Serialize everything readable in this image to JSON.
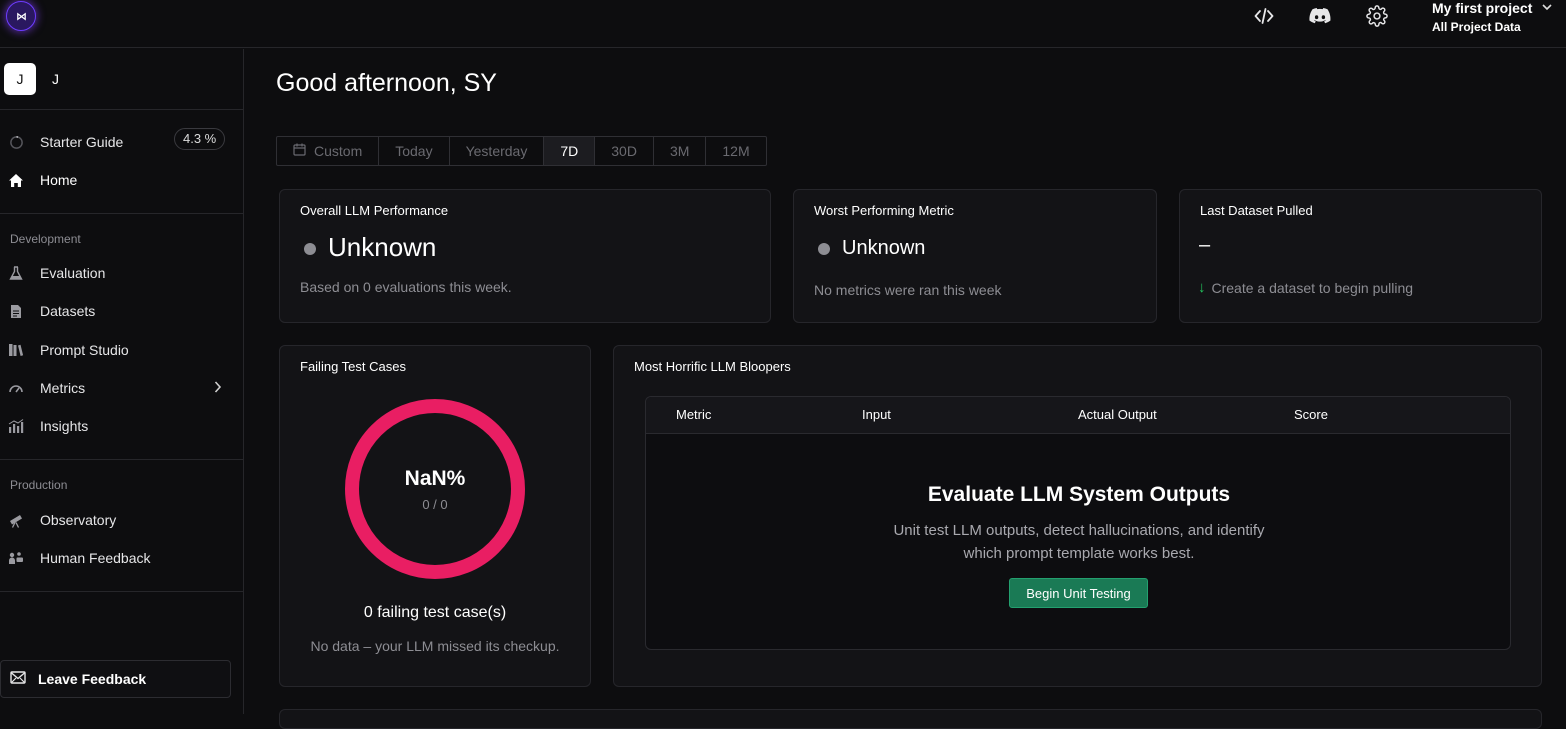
{
  "header": {
    "logo_icon": "brand-logo-icon",
    "code_icon": "code-icon",
    "discord_icon": "discord-icon",
    "settings_icon": "gear-icon",
    "project_name": "My first project",
    "project_scope": "All Project Data"
  },
  "sidebar": {
    "user_initial": "J",
    "user_name": "J",
    "starter_guide": {
      "label": "Starter Guide",
      "progress": "4.3 %"
    },
    "home": "Home",
    "development_label": "Development",
    "development_items": [
      "Evaluation",
      "Datasets",
      "Prompt Studio",
      "Metrics",
      "Insights"
    ],
    "production_label": "Production",
    "production_items": [
      "Observatory",
      "Human Feedback"
    ],
    "feedback_label": "Leave Feedback"
  },
  "main": {
    "greeting": "Good afternoon, SY",
    "ranges": [
      "Custom",
      "Today",
      "Yesterday",
      "7D",
      "30D",
      "3M",
      "12M"
    ],
    "active_range": "7D",
    "overall": {
      "title": "Overall LLM Performance",
      "status": "Unknown",
      "note": "Based on 0 evaluations this week."
    },
    "worst": {
      "title": "Worst Performing Metric",
      "status": "Unknown",
      "note": "No metrics were ran this week"
    },
    "dataset": {
      "title": "Last Dataset Pulled",
      "value": "–",
      "note": "Create a dataset to begin pulling"
    },
    "failing": {
      "title": "Failing Test Cases",
      "percent": "NaN%",
      "ratio": "0 / 0",
      "count_text": "0 failing test case(s)",
      "note": "No data – your LLM missed its checkup.",
      "ring_color": "#e91e63"
    },
    "bloopers": {
      "title": "Most Horrific LLM Bloopers",
      "columns": [
        "Metric",
        "Input",
        "Actual Output",
        "Score"
      ],
      "empty_title": "Evaluate LLM System Outputs",
      "empty_line1": "Unit test LLM outputs, detect hallucinations, and identify",
      "empty_line2": "which prompt template works best.",
      "cta": "Begin Unit Testing"
    }
  }
}
